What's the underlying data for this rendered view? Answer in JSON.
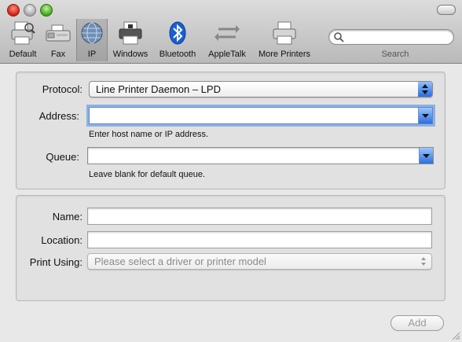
{
  "toolbar": {
    "items": [
      {
        "label": "Default",
        "icon": "default-printer-icon"
      },
      {
        "label": "Fax",
        "icon": "fax-icon"
      },
      {
        "label": "IP",
        "icon": "ip-globe-icon",
        "selected": true
      },
      {
        "label": "Windows",
        "icon": "windows-printer-icon"
      },
      {
        "label": "Bluetooth",
        "icon": "bluetooth-icon"
      },
      {
        "label": "AppleTalk",
        "icon": "appletalk-icon"
      },
      {
        "label": "More Printers",
        "icon": "more-printers-icon"
      }
    ],
    "search_label": "Search",
    "search_placeholder": ""
  },
  "form": {
    "protocol_label": "Protocol:",
    "protocol_value": "Line Printer Daemon – LPD",
    "address_label": "Address:",
    "address_value": "",
    "address_hint": "Enter host name or IP address.",
    "queue_label": "Queue:",
    "queue_value": "",
    "queue_hint": "Leave blank for default queue."
  },
  "details": {
    "name_label": "Name:",
    "name_value": "",
    "location_label": "Location:",
    "location_value": "",
    "print_using_label": "Print Using:",
    "print_using_placeholder": "Please select a driver or printer model"
  },
  "add_button": "Add",
  "colors": {
    "accent_blue": "#2a6fe0",
    "close": "#d41e12",
    "minimize": "#a8a8a8",
    "zoom": "#3fa61b"
  }
}
